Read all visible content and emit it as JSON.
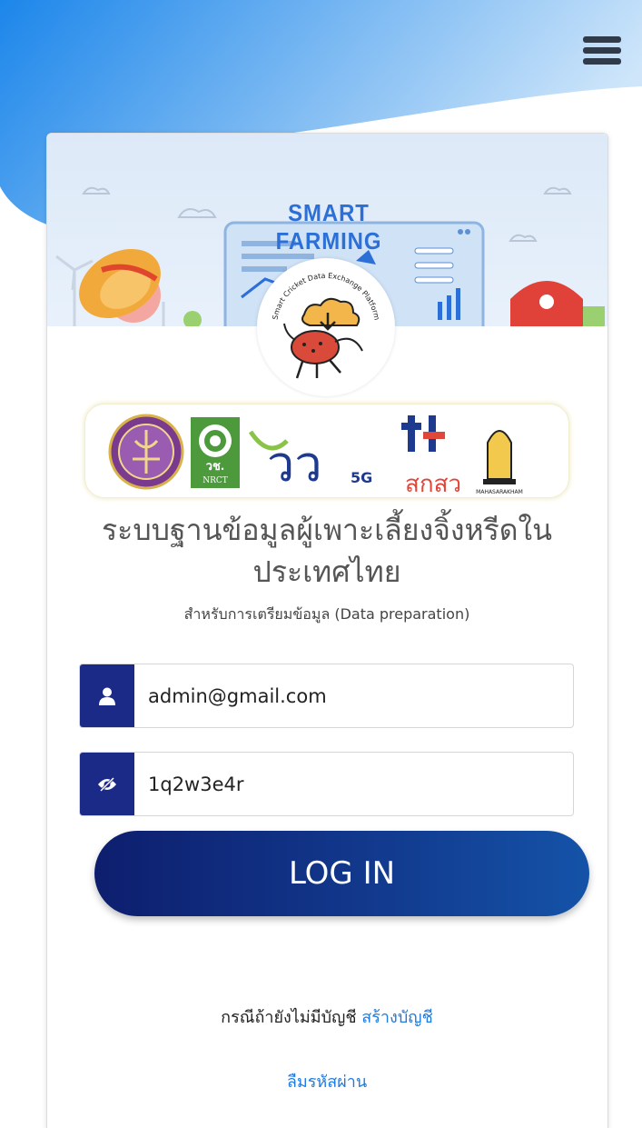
{
  "banner": {
    "title": "SMART FARMING",
    "logo_caption": "Smart Cricket Data Exchange Platform"
  },
  "partners": {
    "nrct_label": "วช.",
    "nrct_sub": "NRCT",
    "fund_mark": "วว",
    "fund_5g": "5G",
    "tsri_label": "สกสว",
    "university_label": "MAHASARAKHAM"
  },
  "title": "ระบบฐานข้อมูลผู้เพาะเลี้ยงจิ้งหรีดในประเทศไทย",
  "subtitle": "สำหรับการเตรียมข้อมูล (Data preparation)",
  "form": {
    "email_value": "admin@gmail.com",
    "password_value": "1q2w3e4r",
    "login_label": "LOG IN"
  },
  "footer": {
    "no_account_text": "กรณีถ้ายังไม่มีบัญชี",
    "signup_link": "สร้างบัญชี",
    "forgot_password": "ลืมรหัสผ่าน"
  },
  "colors": {
    "accent_blue": "#1b2a87",
    "link_blue": "#1e7be0",
    "header_blue": "#1e8fe8"
  }
}
